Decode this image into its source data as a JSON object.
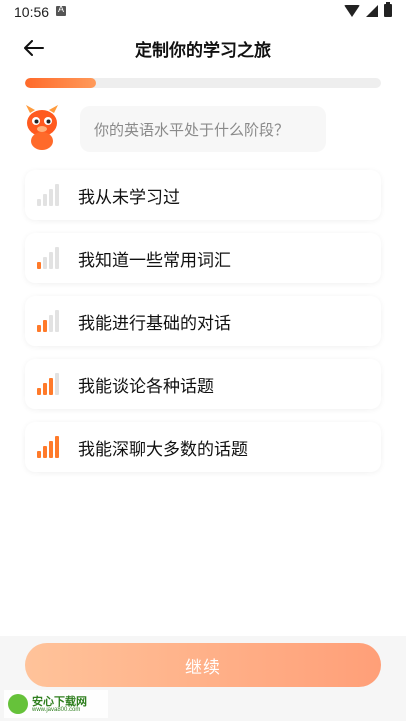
{
  "status_bar": {
    "time": "10:56"
  },
  "header": {
    "back_icon": "arrow-left-icon",
    "title": "定制你的学习之旅"
  },
  "progress": {
    "fraction": 0.2,
    "color": "#ff6a2a"
  },
  "question": {
    "text": "你的英语水平处于什么阶段？"
  },
  "options": [
    {
      "label": "我从未学习过",
      "level": 1
    },
    {
      "label": "我知道一些常用词汇",
      "level": 2
    },
    {
      "label": "我能进行基础的对话",
      "level": 3
    },
    {
      "label": "我能谈论各种话题",
      "level": 4
    },
    {
      "label": "我能深聊大多数的话题",
      "level": 5
    }
  ],
  "continue_button": {
    "label": "继续"
  },
  "watermark": {
    "main": "安心下载网",
    "sub": "www.java800.com"
  },
  "colors": {
    "accent": "#ff7a2a",
    "button_gradient_start": "#ffc39a",
    "button_gradient_end": "#ff9f78"
  }
}
